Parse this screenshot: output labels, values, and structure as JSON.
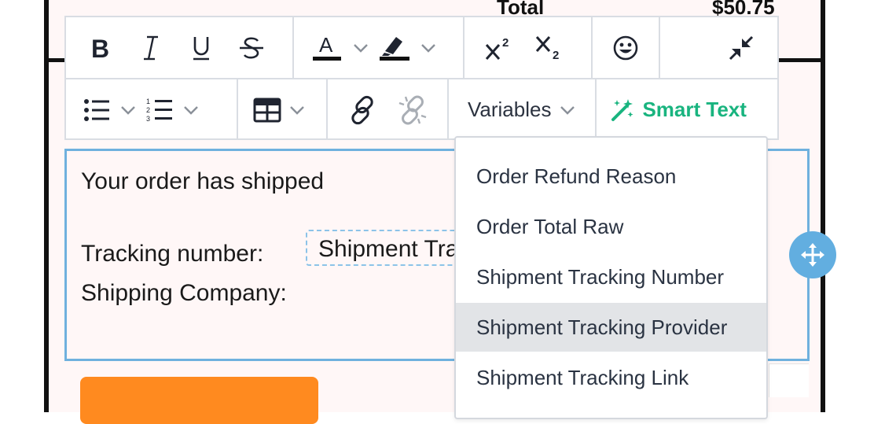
{
  "email": {
    "total_label": "Total",
    "total_value": "$50.75",
    "body_line1": "Your order has shipped",
    "tracking_label": "Tracking number:",
    "tracking_variable": "Shipment Tracking Number",
    "shipping_label": "Shipping Company:"
  },
  "toolbar": {
    "variables_label": "Variables",
    "smart_text_label": "Smart Text",
    "smart_text_color": "#19b47f",
    "icons": [
      "bold-icon",
      "italic-icon",
      "underline-icon",
      "strikethrough-icon",
      "font-color-icon",
      "highlight-icon",
      "superscript-icon",
      "subscript-icon",
      "emoji-icon",
      "collapse-icon",
      "bulleted-list-icon",
      "numbered-list-icon",
      "table-icon",
      "link-icon",
      "unlink-icon",
      "magic-wand-icon"
    ],
    "superscript_digit": "2",
    "subscript_digit": "2",
    "font_color_letter": "A"
  },
  "variables_dropdown": {
    "items": [
      "Order Refund Reason",
      "Order Total Raw",
      "Shipment Tracking Number",
      "Shipment Tracking Provider",
      "Shipment Tracking Link"
    ],
    "highlighted": "Shipment Tracking Provider"
  },
  "colors": {
    "editor_border": "#6fb1de",
    "move_handle": "#62aee0",
    "cta_button": "#ff8a1f"
  }
}
